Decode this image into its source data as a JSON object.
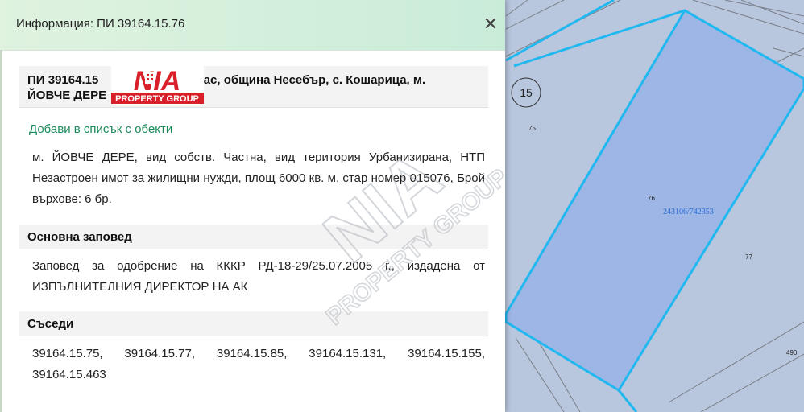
{
  "panel": {
    "title": "Информация: ПИ 39164.15.76",
    "close_icon": "close-icon",
    "heading": "ПИ 39164.15.76, гр. Бургас, община Несебър, с. Кошарица, м. ЙОВЧЕ ДЕРЕ",
    "heading_line1_start": "ПИ 39164.15",
    "heading_line1_end": "ргас, община Несебър, с. Кошарица, м.",
    "heading_line2": "ЙОВЧЕ ДЕРЕ",
    "add_link": "Добави в списък с обекти",
    "description": "м. ЙОВЧЕ ДЕРЕ, вид собств. Частна, вид територия Урбанизирана, НТП Незастроен имот за жилищни нужди, площ 6000 кв. м, стар номер 015076, Брой върхове: 6 бр.",
    "order_heading": "Основна заповед",
    "order_text": "Заповед за одобрение на КККР РД-18-29/25.07.2005 г., издадена от ИЗПЪЛНИТЕЛНИЯ ДИРЕКТОР НА АК",
    "neighbors_heading": "Съседи",
    "neighbors_text": "39164.15.75, 39164.15.77, 39164.15.85, 39164.15.131, 39164.15.155, 39164.15.463"
  },
  "logo": {
    "text_big": "NIA",
    "text_small": "PROPERTY GROUP",
    "color_red": "#d8202a",
    "color_blue": "#1e3a8a"
  },
  "watermark": {
    "text_big": "NIA",
    "text_small": "PROPERTY GROUP"
  },
  "map": {
    "badge": "15",
    "labels": [
      "75",
      "76",
      "243106/742353",
      "77",
      "490"
    ],
    "highlight_color": "#9db6e6",
    "line_color": "#21b8f0"
  }
}
